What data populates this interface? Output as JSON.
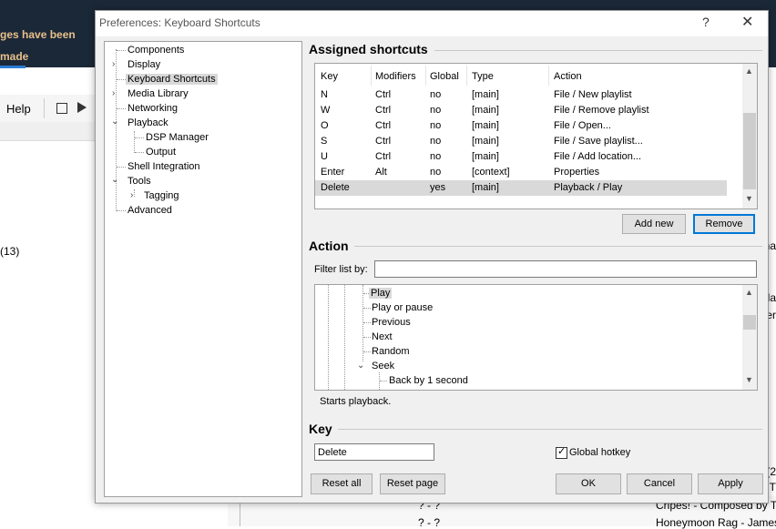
{
  "background": {
    "notice_text": "ges have been made",
    "help_menu": "Help",
    "count_text": "(13)",
    "right_clips": [
      "ha",
      "gla",
      "er",
      "(2",
      "- T"
    ],
    "bottom_rows": [
      {
        "time": "? - ?",
        "title": "Cripes! - Composed by To"
      },
      {
        "time": "? - ?",
        "title": "Honeymoon Rag - James"
      }
    ]
  },
  "dialog": {
    "title": "Preferences: Keyboard Shortcuts",
    "help_glyph": "?",
    "close_glyph": "✕"
  },
  "tree": {
    "items": [
      {
        "label": "Components"
      },
      {
        "label": "Display"
      },
      {
        "label": "Keyboard Shortcuts"
      },
      {
        "label": "Media Library"
      },
      {
        "label": "Networking"
      },
      {
        "label": "Playback"
      },
      {
        "label": "DSP Manager"
      },
      {
        "label": "Output"
      },
      {
        "label": "Shell Integration"
      },
      {
        "label": "Tools"
      },
      {
        "label": "Tagging"
      },
      {
        "label": "Advanced"
      }
    ],
    "selected": "Keyboard Shortcuts"
  },
  "assigned": {
    "title": "Assigned shortcuts",
    "columns": [
      "Key",
      "Modifiers",
      "Global",
      "Type",
      "Action"
    ],
    "rows": [
      {
        "key": "N",
        "modifiers": "Ctrl",
        "global": "no",
        "type": "[main]",
        "action": "File / New playlist"
      },
      {
        "key": "W",
        "modifiers": "Ctrl",
        "global": "no",
        "type": "[main]",
        "action": "File / Remove playlist"
      },
      {
        "key": "O",
        "modifiers": "Ctrl",
        "global": "no",
        "type": "[main]",
        "action": "File / Open..."
      },
      {
        "key": "S",
        "modifiers": "Ctrl",
        "global": "no",
        "type": "[main]",
        "action": "File / Save playlist..."
      },
      {
        "key": "U",
        "modifiers": "Ctrl",
        "global": "no",
        "type": "[main]",
        "action": "File / Add location..."
      },
      {
        "key": "Enter",
        "modifiers": "Alt",
        "global": "no",
        "type": "[context]",
        "action": "Properties"
      },
      {
        "key": "Delete",
        "modifiers": "",
        "global": "yes",
        "type": "[main]",
        "action": "Playback / Play"
      }
    ],
    "add_new_label": "Add new",
    "remove_label": "Remove"
  },
  "action": {
    "title": "Action",
    "filter_label": "Filter list by:",
    "filter_value": "",
    "items": [
      {
        "label": "Play"
      },
      {
        "label": "Play or pause"
      },
      {
        "label": "Previous"
      },
      {
        "label": "Next"
      },
      {
        "label": "Random"
      },
      {
        "label": "Seek"
      },
      {
        "label": "Back by 1 second"
      }
    ],
    "selected": "Play",
    "description": "Starts playback."
  },
  "key": {
    "title": "Key",
    "value": "Delete",
    "global_hotkey_label": "Global hotkey",
    "global_hotkey_checked": true
  },
  "footer": {
    "reset_all": "Reset all",
    "reset_page": "Reset page",
    "ok": "OK",
    "cancel": "Cancel",
    "apply": "Apply"
  },
  "colors": {
    "background_dark": "#1b2838",
    "notice_text": "#e8c08a",
    "selection": "#d9d9d9",
    "default_button_border": "#0078d7",
    "dialog_bg": "#f0f0f0"
  }
}
